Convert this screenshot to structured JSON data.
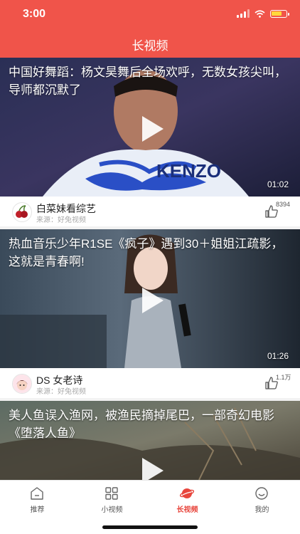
{
  "status": {
    "time": "3:00",
    "battery_level": 0.75
  },
  "header": {
    "title": "长视频"
  },
  "videos": [
    {
      "title": "中国好舞蹈：杨文昊舞后全场欢呼，无数女孩尖叫，导师都沉默了",
      "duration": "01:02",
      "author": "白菜妹看综艺",
      "source": "来源：好兔视频",
      "likes": "8394",
      "avatar_icon": "cherry-icon"
    },
    {
      "title": "热血音乐少年R1SE《疯子》遇到30＋姐姐江疏影，这就是青春啊!",
      "duration": "01:26",
      "author": "DS 女老诗",
      "source": "来源：好兔视频",
      "likes": "1.1万",
      "avatar_icon": "cartoon-girl-icon"
    },
    {
      "title": "美人鱼误入渔网，被渔民摘掉尾巴，一部奇幻电影《堕落人鱼》"
    }
  ],
  "tabs": [
    {
      "label": "推荐",
      "icon": "home-icon",
      "active": false
    },
    {
      "label": "小视频",
      "icon": "grid-icon",
      "active": false
    },
    {
      "label": "长视频",
      "icon": "planet-icon",
      "active": true
    },
    {
      "label": "我的",
      "icon": "smiley-icon",
      "active": false
    }
  ],
  "colors": {
    "brand": "#f0544a",
    "active_tab": "#e8463d"
  }
}
